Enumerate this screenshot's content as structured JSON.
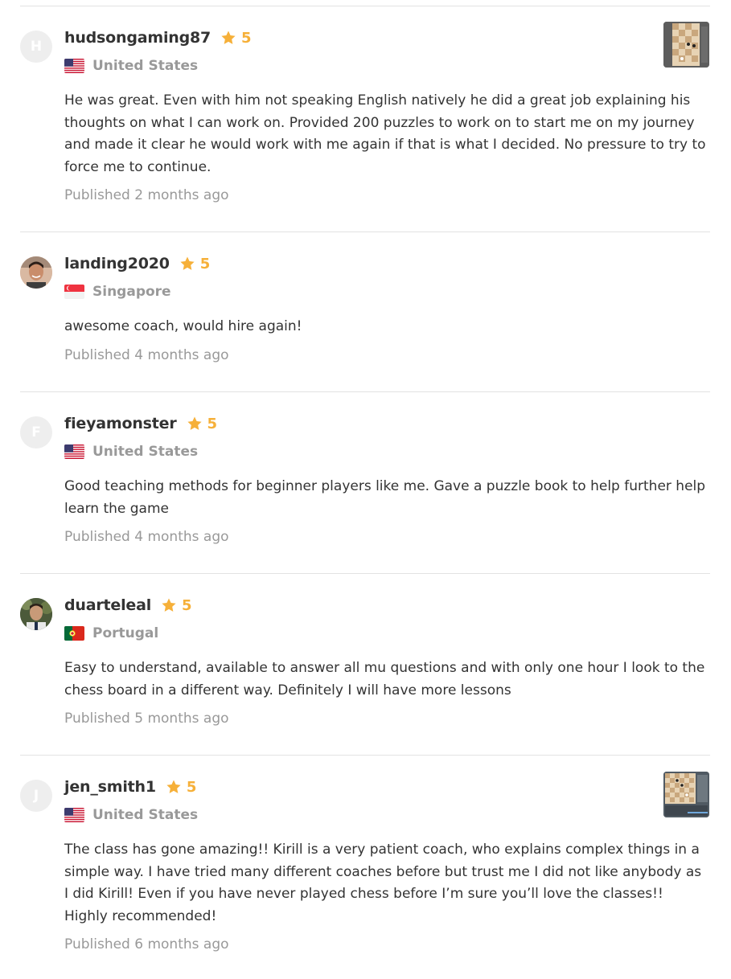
{
  "reviews": [
    {
      "avatar_initial": "H",
      "avatar_type": "initial",
      "username": "hudsongaming87",
      "star_icon": "star-icon",
      "rating": "5",
      "flag": "us-flag-icon",
      "country": "United States",
      "text": "He was great. Even with him not speaking English natively he did a great job explaining his thoughts on what I can work on. Provided 200 puzzles to work on to start me on my journey and made it clear he would work with me again if that is what I decided. No pressure to try to force me to continue.",
      "published": "Published 2 months ago",
      "has_thumbnail": true
    },
    {
      "avatar_initial": "",
      "avatar_type": "photo",
      "username": "landing2020",
      "star_icon": "star-icon",
      "rating": "5",
      "flag": "singapore-flag-icon",
      "country": "Singapore",
      "text": "awesome coach, would hire again!",
      "published": "Published 4 months ago",
      "has_thumbnail": false
    },
    {
      "avatar_initial": "F",
      "avatar_type": "initial",
      "username": "fieyamonster",
      "star_icon": "star-icon",
      "rating": "5",
      "flag": "us-flag-icon",
      "country": "United States",
      "text": "Good teaching methods for beginner players like me. Gave a puzzle book to help further help learn the game",
      "published": "Published 4 months ago",
      "has_thumbnail": false
    },
    {
      "avatar_initial": "",
      "avatar_type": "photo",
      "username": "duarteleal",
      "star_icon": "star-icon",
      "rating": "5",
      "flag": "portugal-flag-icon",
      "country": "Portugal",
      "text": "Easy to understand, available to answer all mu questions and with only one hour I look to the chess board in a different way. Definitely I will have more lessons",
      "published": "Published 5 months ago",
      "has_thumbnail": false
    },
    {
      "avatar_initial": "J",
      "avatar_type": "initial",
      "username": "jen_smith1",
      "star_icon": "star-icon",
      "rating": "5",
      "flag": "us-flag-icon",
      "country": "United States",
      "text": "The class has gone amazing!! Kirill is a very patient coach, who explains complex things in a simple way. I have tried many different coaches before but trust me I did not like anybody as I did Kirill! Even if you have never played chess before I’m sure you’ll love the classes!! Highly recommended!",
      "published": "Published 6 months ago",
      "has_thumbnail": true
    }
  ],
  "colors": {
    "star": "#f6b039",
    "muted_text": "#999999",
    "body_text": "#333333",
    "divider": "#e2e2e2",
    "avatar_bg": "#eeeeee"
  }
}
